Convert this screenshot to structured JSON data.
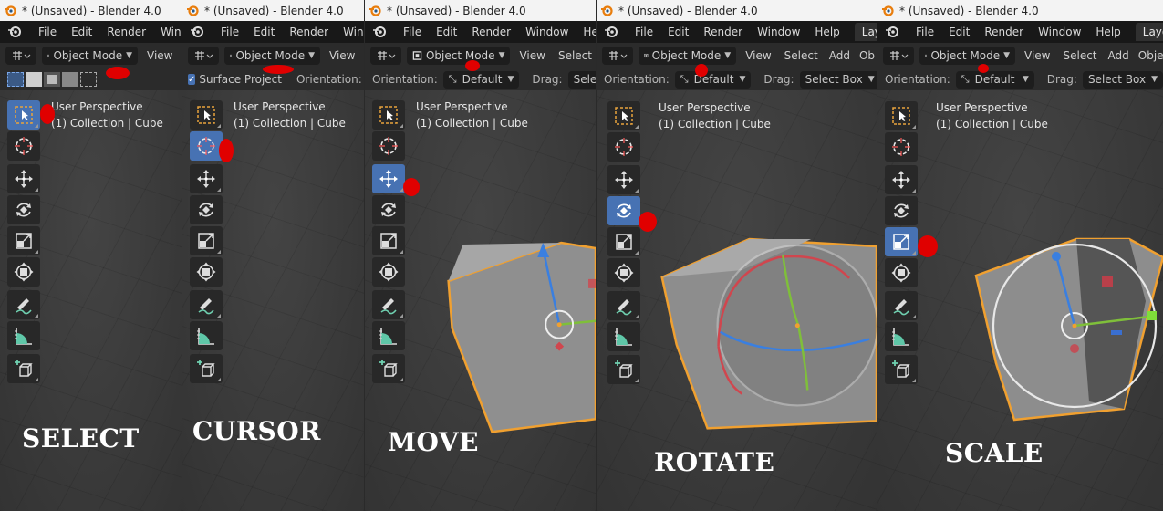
{
  "window_title": "* (Unsaved) - Blender 4.0",
  "menu": [
    "File",
    "Edit",
    "Render",
    "Window",
    "Help"
  ],
  "workspace_tab": "Layout",
  "header": {
    "mode": "Object Mode",
    "view": "View",
    "select": "Select",
    "add": "Add",
    "object_short": "Ob",
    "object_short2": "Obje"
  },
  "subheader": {
    "surface_project": "Surface Project",
    "orientation_label": "Orientation:",
    "orientation_value": "Default",
    "drag_label": "Drag:",
    "drag_value": "Select Box",
    "drag_value_short": "Selec",
    "orientation_short": "V"
  },
  "viewport": {
    "perspective": "User Perspective",
    "collection": "(1) Collection | Cube"
  },
  "panels": [
    {
      "caption": "SELECT",
      "active_tool": "select-box"
    },
    {
      "caption": "CURSOR",
      "active_tool": "cursor"
    },
    {
      "caption": "MOVE",
      "active_tool": "move"
    },
    {
      "caption": "ROTATE",
      "active_tool": "rotate"
    },
    {
      "caption": "SCALE",
      "active_tool": "scale"
    }
  ],
  "icons": [
    "blender-logo-icon",
    "select-box-icon",
    "cursor-icon",
    "move-icon",
    "rotate-icon",
    "scale-icon",
    "transform-icon",
    "annotate-icon",
    "measure-icon",
    "add-cube-icon",
    "chevron-down-icon"
  ],
  "colors": {
    "active_tool": "#4772b3",
    "cube_outline": "#f0a030",
    "axis_x": "#d0464e",
    "axis_y": "#7fbf3a",
    "axis_z": "#3a7fe0",
    "annotation": "#e00000"
  }
}
